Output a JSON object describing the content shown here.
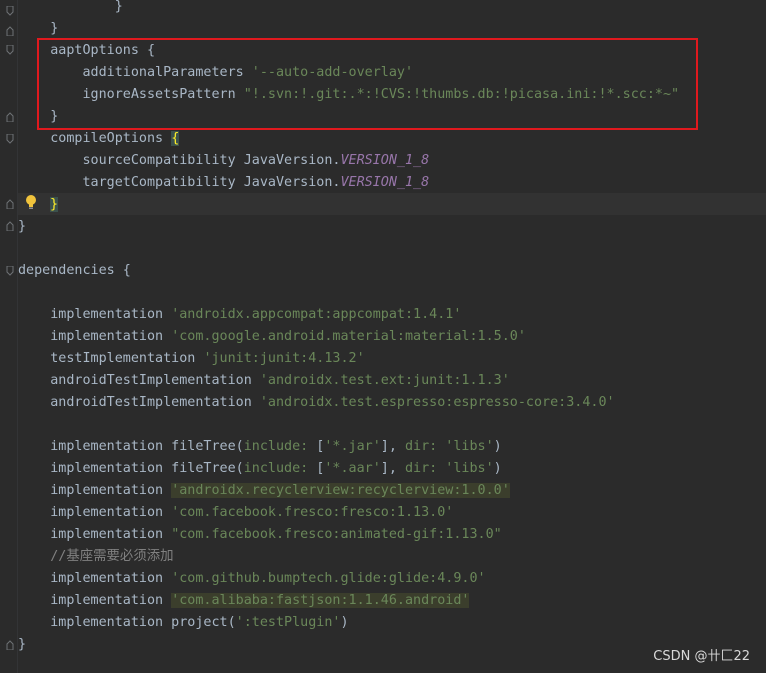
{
  "editor": {
    "lines": [
      {
        "id": "l0",
        "text": "            }"
      },
      {
        "id": "l1",
        "text": "    }"
      },
      {
        "id": "l2",
        "text": "    aaptOptions {"
      },
      {
        "id": "l3a",
        "text": "        additionalParameters "
      },
      {
        "id": "l3b",
        "text": "'--auto-add-overlay'"
      },
      {
        "id": "l4a",
        "text": "        ignoreAssetsPattern "
      },
      {
        "id": "l4b",
        "text": "\"!.svn:!.git:.*:!CVS:!thumbs.db:!picasa.ini:!*.scc:*~\""
      },
      {
        "id": "l5",
        "text": "    }"
      },
      {
        "id": "l6a",
        "text": "    compileOptions "
      },
      {
        "id": "l6b",
        "text": "{"
      },
      {
        "id": "l7a",
        "text": "        sourceCompatibility JavaVersion."
      },
      {
        "id": "l7b",
        "text": "VERSION_1_8"
      },
      {
        "id": "l8a",
        "text": "        targetCompatibility JavaVersion."
      },
      {
        "id": "l8b",
        "text": "VERSION_1_8"
      },
      {
        "id": "l9",
        "text": "}"
      },
      {
        "id": "l10",
        "text": "}"
      },
      {
        "id": "l12",
        "text": "dependencies {"
      },
      {
        "id": "d1a",
        "text": "    implementation "
      },
      {
        "id": "d1b",
        "text": "'androidx.appcompat:appcompat:1.4.1'"
      },
      {
        "id": "d2a",
        "text": "    implementation "
      },
      {
        "id": "d2b",
        "text": "'com.google.android.material:material:1.5.0'"
      },
      {
        "id": "d3a",
        "text": "    testImplementation "
      },
      {
        "id": "d3b",
        "text": "'junit:junit:4.13.2'"
      },
      {
        "id": "d4a",
        "text": "    androidTestImplementation "
      },
      {
        "id": "d4b",
        "text": "'androidx.test.ext:junit:1.1.3'"
      },
      {
        "id": "d5a",
        "text": "    androidTestImplementation "
      },
      {
        "id": "d5b",
        "text": "'androidx.test.espresso:espresso-core:3.4.0'"
      },
      {
        "id": "f1a",
        "text": "    implementation fileTree("
      },
      {
        "id": "f1b",
        "text": "include: "
      },
      {
        "id": "f1c",
        "text": "["
      },
      {
        "id": "f1d",
        "text": "'*.jar'"
      },
      {
        "id": "f1e",
        "text": "], "
      },
      {
        "id": "f1f",
        "text": "dir: "
      },
      {
        "id": "f1g",
        "text": "'libs'"
      },
      {
        "id": "f1h",
        "text": ")"
      },
      {
        "id": "f2a",
        "text": "    implementation fileTree("
      },
      {
        "id": "f2b",
        "text": "include: "
      },
      {
        "id": "f2c",
        "text": "["
      },
      {
        "id": "f2d",
        "text": "'*.aar'"
      },
      {
        "id": "f2e",
        "text": "], "
      },
      {
        "id": "f2f",
        "text": "dir: "
      },
      {
        "id": "f2g",
        "text": "'libs'"
      },
      {
        "id": "f2h",
        "text": ")"
      },
      {
        "id": "r1a",
        "text": "    implementation "
      },
      {
        "id": "r1b",
        "text": "'androidx.recyclerview:recyclerview:1.0.0'"
      },
      {
        "id": "r2a",
        "text": "    implementation "
      },
      {
        "id": "r2b",
        "text": "'com.facebook.fresco:fresco:1.13.0'"
      },
      {
        "id": "r3a",
        "text": "    implementation "
      },
      {
        "id": "r3b",
        "text": "\"com.facebook.fresco:animated-gif:1.13.0\""
      },
      {
        "id": "c1",
        "text": "    //基座需要必须添加"
      },
      {
        "id": "g1a",
        "text": "    implementation "
      },
      {
        "id": "g1b",
        "text": "'com.github.bumptech.glide:glide:4.9.0'"
      },
      {
        "id": "g2a",
        "text": "    implementation "
      },
      {
        "id": "g2b",
        "text": "'com.alibaba:fastjson:1.1.46.android'"
      },
      {
        "id": "p1a",
        "text": "    implementation project("
      },
      {
        "id": "p1b",
        "text": "':testPlugin'"
      },
      {
        "id": "p1c",
        "text": ")"
      },
      {
        "id": "end",
        "text": "}"
      }
    ]
  },
  "watermark": "CSDN @卄匚22",
  "colors": {
    "background": "#2b2b2b",
    "text": "#a9b7c6",
    "string": "#6a8759",
    "constant": "#9876aa",
    "comment": "#808080",
    "highlight_box": "#e0191e",
    "bulb": "#f0c33c"
  },
  "icons": {
    "bulb": "intention-bulb-icon",
    "fold": "fold-marker-icon"
  }
}
